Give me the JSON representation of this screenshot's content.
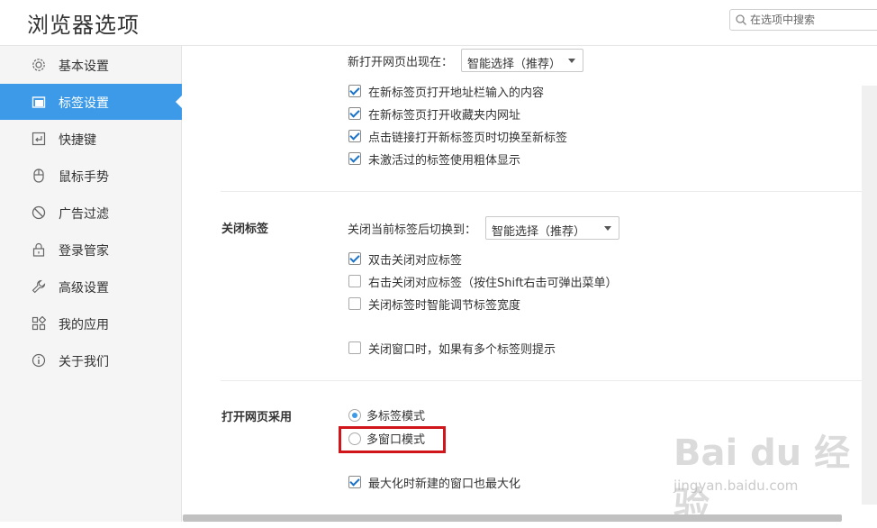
{
  "header": {
    "title": "浏览器选项",
    "search_placeholder": "在选项中搜索"
  },
  "sidebar": {
    "items": [
      {
        "label": "基本设置",
        "icon": "gear-icon",
        "active": false
      },
      {
        "label": "标签设置",
        "icon": "tab-icon",
        "active": true
      },
      {
        "label": "快捷键",
        "icon": "keyboard-icon",
        "active": false
      },
      {
        "label": "鼠标手势",
        "icon": "mouse-icon",
        "active": false
      },
      {
        "label": "广告过滤",
        "icon": "block-icon",
        "active": false
      },
      {
        "label": "登录管家",
        "icon": "lock-icon",
        "active": false
      },
      {
        "label": "高级设置",
        "icon": "wrench-icon",
        "active": false
      },
      {
        "label": "我的应用",
        "icon": "apps-icon",
        "active": false
      },
      {
        "label": "关于我们",
        "icon": "info-icon",
        "active": false
      }
    ]
  },
  "new_tab": {
    "open_label": "新打开网页出现在：",
    "open_select": "智能选择（推荐）",
    "options": [
      {
        "label": "在新标签页打开地址栏输入的内容",
        "checked": true
      },
      {
        "label": "在新标签页打开收藏夹内网址",
        "checked": true
      },
      {
        "label": "点击链接打开新标签页时切换至新标签",
        "checked": true
      },
      {
        "label": "未激活过的标签使用粗体显示",
        "checked": true
      }
    ]
  },
  "close_tab": {
    "title": "关闭标签",
    "switch_label": "关闭当前标签后切换到：",
    "switch_select": "智能选择（推荐）",
    "options": [
      {
        "label": "双击关闭对应标签",
        "checked": true
      },
      {
        "label": "右击关闭对应标签（按住Shift右击可弹出菜单）",
        "checked": false
      },
      {
        "label": "关闭标签时智能调节标签宽度",
        "checked": false
      },
      {
        "label": "关闭窗口时，如果有多个标签则提示",
        "checked": false
      }
    ]
  },
  "open_mode": {
    "title": "打开网页采用",
    "radios": [
      {
        "label": "多标签模式",
        "selected": true
      },
      {
        "label": "多窗口模式",
        "selected": false
      }
    ],
    "maximize_label": "最大化时新建的窗口也最大化",
    "maximize_checked": true
  },
  "watermark": {
    "main": "Bai du 经验",
    "sub": "jingyan.baidu.com"
  },
  "colors": {
    "accent": "#3c9ae8",
    "highlight_box": "#d0161b",
    "sidebar_bg": "#f5f5f5"
  }
}
